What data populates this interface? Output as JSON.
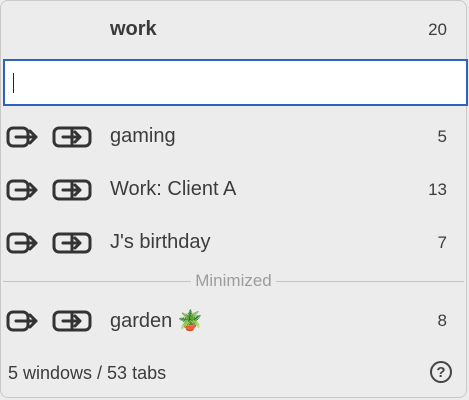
{
  "header": {
    "title": "work",
    "count": "20"
  },
  "search": {
    "value": "",
    "placeholder": ""
  },
  "windows": [
    {
      "name": "gaming",
      "count": "5"
    },
    {
      "name": "Work: Client A",
      "count": "13"
    },
    {
      "name": "J's birthday",
      "count": "7"
    }
  ],
  "minimized_label": "Minimized",
  "minimized_windows": [
    {
      "name": "garden 🪴",
      "count": "8"
    }
  ],
  "footer": {
    "summary": "5 windows / 53 tabs",
    "help": "?"
  },
  "colors": {
    "focus_border": "#2f62c0",
    "background": "#ececec",
    "text": "#3c3c3c",
    "muted": "#9c9c9c"
  },
  "icons": {
    "open": "arrow-into-window-icon",
    "move": "arrow-between-windows-icon",
    "help": "question-circle-icon"
  }
}
